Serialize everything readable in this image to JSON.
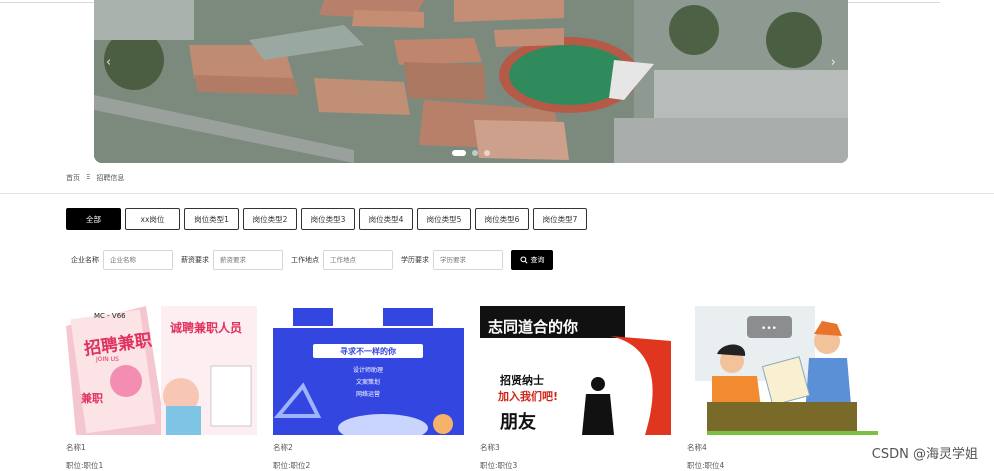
{
  "carousel": {
    "prev_icon": "‹",
    "next_icon": "›",
    "dots": 3,
    "active_dot": 0
  },
  "breadcrumb": {
    "home": "首页",
    "separator": "Ξ",
    "current": "招聘信息"
  },
  "tabs": [
    {
      "label": "全部",
      "active": true
    },
    {
      "label": "xx岗位"
    },
    {
      "label": "岗位类型1"
    },
    {
      "label": "岗位类型2"
    },
    {
      "label": "岗位类型3"
    },
    {
      "label": "岗位类型4"
    },
    {
      "label": "岗位类型5"
    },
    {
      "label": "岗位类型6"
    },
    {
      "label": "岗位类型7"
    }
  ],
  "filters": {
    "company": {
      "label": "企业名称",
      "placeholder": "企业名称"
    },
    "salary": {
      "label": "薪资要求",
      "placeholder": "薪资要求"
    },
    "location": {
      "label": "工作地点",
      "placeholder": "工作地点"
    },
    "education": {
      "label": "学历要求",
      "placeholder": "学历要求"
    },
    "search_label": "查询"
  },
  "cards": [
    {
      "name": "名称1",
      "position": "职位:职位1",
      "image_text": {
        "l1": "招聘兼职",
        "l2": "诚聘兼职人员",
        "l3": "兼职",
        "l4": "MC - V66",
        "l5": "JOIN US"
      }
    },
    {
      "name": "名称2",
      "position": "职位:职位2",
      "image_text": {
        "l1": "寻求不一样的你",
        "l2": "设计师助理",
        "l3": "文案策划",
        "l4": "网络运营"
      }
    },
    {
      "name": "名称3",
      "position": "职位:职位3",
      "image_text": {
        "l1": "志同道合的你",
        "l2": "招贤纳士",
        "l3": "加入我们吧!",
        "l4": "朋友"
      }
    },
    {
      "name": "名称4",
      "position": "职位:职位4",
      "image_text": {
        "l1": "•••"
      }
    }
  ],
  "watermark": "CSDN @海灵学姐"
}
